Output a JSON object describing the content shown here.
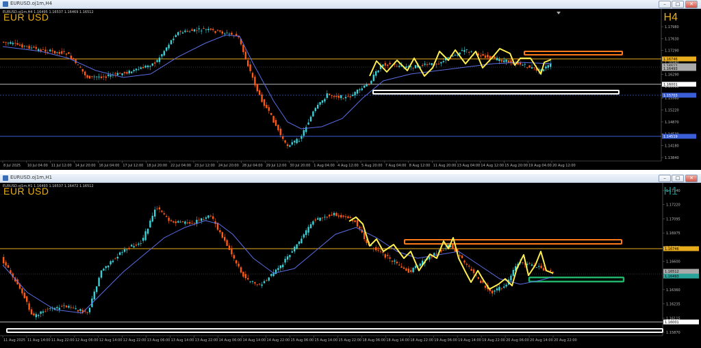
{
  "windows": [
    {
      "id": "h4",
      "title": "EURUSD.oj1m,H4",
      "info": "EURUSD.oj1m,H4 1.16495 1.16537 1.16469 1.16512",
      "symbol": "EUR USD",
      "timeframe": "H4",
      "timeframe_color": "#e7ad1c",
      "price_labels": [
        "1.17980",
        "1.17630",
        "1.17290",
        "1.16940",
        "1.16290",
        "1.15910",
        "1.15560",
        "1.15220",
        "1.14870",
        "1.14530",
        "1.14180",
        "1.13840"
      ],
      "highlighted_labels": [
        {
          "text": "1.16746",
          "color": "#e7ad1c",
          "text_color": "#000"
        },
        {
          "text": "1.16512",
          "color": "#aaaaaa",
          "text_color": "#000"
        },
        {
          "text": "1.16493",
          "color": "#aaaaaa",
          "text_color": "#000"
        },
        {
          "text": "1.16001",
          "color": "#ffffff",
          "text_color": "#000"
        },
        {
          "text": "1.15703",
          "color": "#3b5fd6",
          "text_color": "#fff"
        },
        {
          "text": "1.14519",
          "color": "#3b5fd6",
          "text_color": "#fff"
        }
      ],
      "time_labels": [
        "8 Jul 2025",
        "10 Jul 04:00",
        "11 Jul 12:00",
        "14 Jul 20:00",
        "16 Jul 04:00",
        "17 Jul 12:00",
        "18 Jul 20:00",
        "22 Jul 04:00",
        "23 Jul 12:00",
        "24 Jul 20:00",
        "28 Jul 04:00",
        "29 Jul 12:00",
        "30 Jul 20:00",
        "1 Aug 04:00",
        "4 Aug 12:00",
        "5 Aug 20:00",
        "7 Aug 04:00",
        "8 Aug 12:00",
        "11 Aug 20:00",
        "13 Aug 04:00",
        "14 Aug 12:00",
        "15 Aug 20:00",
        "19 Aug 04:00",
        "20 Aug 12:00"
      ]
    },
    {
      "id": "h1",
      "title": "EURUSD.oj1m,H1",
      "info": "EURUSD.oj1m,H1 1.16493 1.16537 1.16472 1.16512",
      "symbol": "EUR USD",
      "timeframe": "H1",
      "timeframe_color": "#1a8a86",
      "price_labels": [
        "1.17340",
        "1.17220",
        "1.17095",
        "1.16975",
        "1.16850",
        "1.16600",
        "1.16480",
        "1.16360",
        "1.16235",
        "1.16115",
        "1.15870"
      ],
      "highlighted_labels": [
        {
          "text": "1.16746",
          "color": "#e7ad1c",
          "text_color": "#000"
        },
        {
          "text": "1.16512",
          "color": "#aaaaaa",
          "text_color": "#000"
        },
        {
          "text": "1.16493",
          "color": "#2aa39a",
          "text_color": "#000"
        },
        {
          "text": "1.16001",
          "color": "#ffffff",
          "text_color": "#000"
        }
      ],
      "time_labels": [
        "11 Aug 2025",
        "11 Aug 14:00",
        "11 Aug 22:00",
        "12 Aug 06:00",
        "12 Aug 14:00",
        "12 Aug 22:00",
        "13 Aug 06:00",
        "13 Aug 14:00",
        "13 Aug 22:00",
        "14 Aug 06:00",
        "14 Aug 14:00",
        "14 Aug 22:00",
        "15 Aug 06:00",
        "15 Aug 14:00",
        "15 Aug 22:00",
        "18 Aug 06:00",
        "18 Aug 14:00",
        "18 Aug 22:00",
        "19 Aug 06:00",
        "19 Aug 14:00",
        "19 Aug 22:00",
        "20 Aug 06:00",
        "20 Aug 14:00",
        "20 Aug 22:00"
      ]
    }
  ],
  "colors": {
    "bull": "#3ad1d8",
    "bear": "#ff5a14",
    "ma": "#5a6ee6",
    "zigzag": "#ffee50",
    "resistance_line": "#e7ad1c",
    "support_box": "#ffffff",
    "orange_zone": "#ff7a1a",
    "green_zone": "#22b36a"
  }
}
